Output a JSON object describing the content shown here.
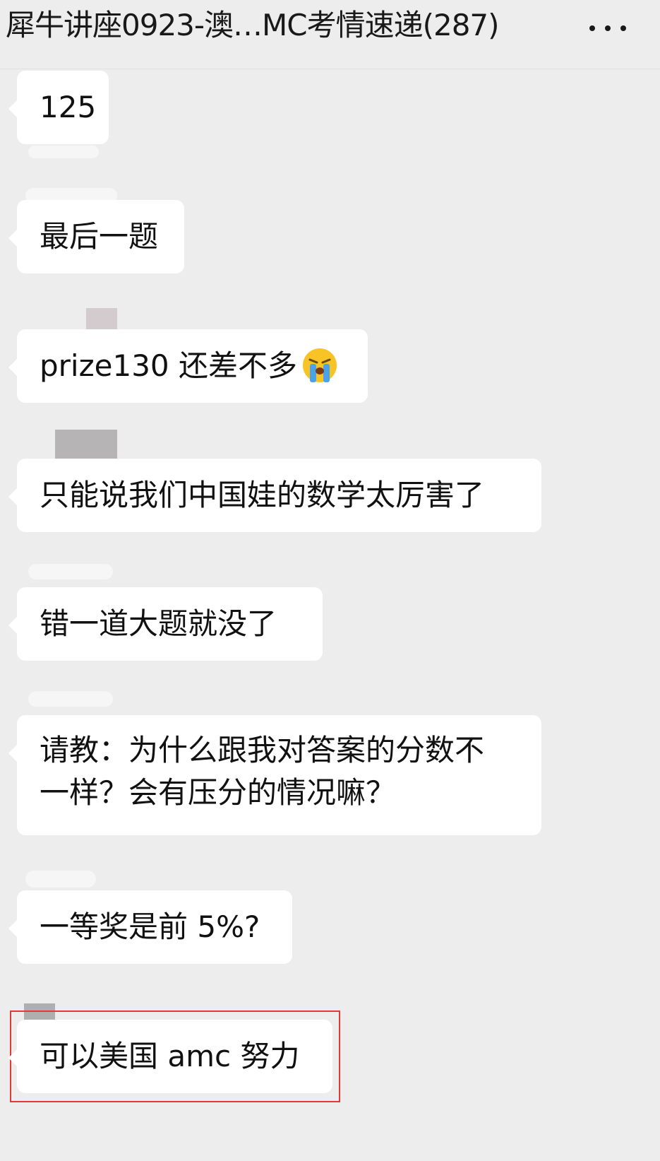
{
  "header": {
    "title": "犀牛讲座0923-澳…MC考情速递(287)",
    "more_icon": "more-icon"
  },
  "messages": [
    {
      "text": "125"
    },
    {
      "text": "最后一题"
    },
    {
      "text": "prize130 还差不多",
      "emoji": "loudly-crying-face"
    },
    {
      "text": "只能说我们中国娃的数学太厉害了"
    },
    {
      "text": "错一道大题就没了"
    },
    {
      "line1": "请教：为什么跟我对答案的分数不",
      "line2": "一样？会有压分的情况嘛？"
    },
    {
      "text": "一等奖是前 5%?"
    },
    {
      "text": "可以美国 amc 努力",
      "highlighted": true
    }
  ],
  "colors": {
    "background": "#ededed",
    "bubble": "#ffffff",
    "highlight_border": "#e53935",
    "text": "#111111"
  }
}
